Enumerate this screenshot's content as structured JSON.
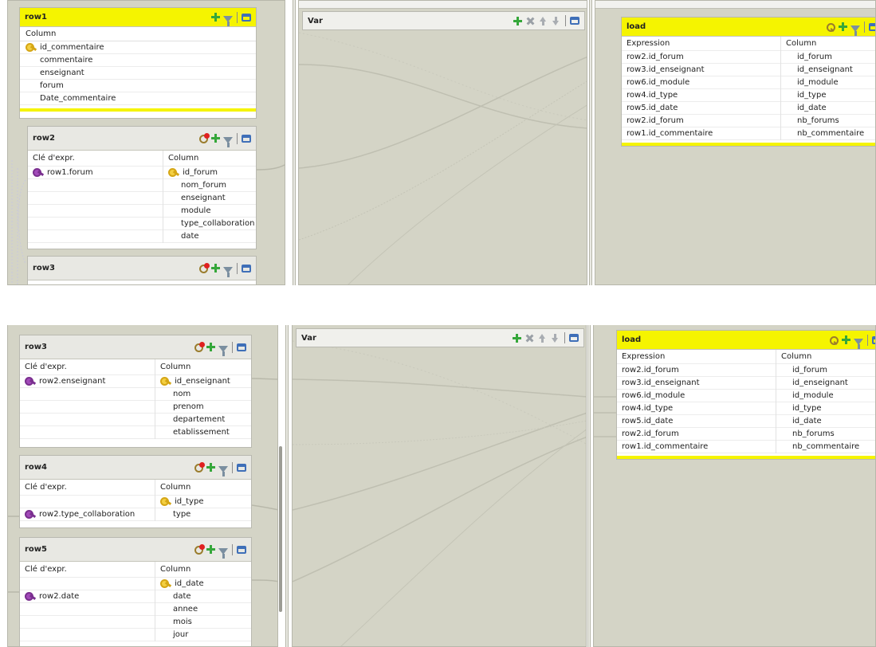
{
  "top": {
    "row1": {
      "title": "row1",
      "column_header": "Column",
      "columns": [
        "id_commentaire",
        "commentaire",
        "enseignant",
        "forum",
        "Date_commentaire"
      ]
    },
    "row2": {
      "title": "row2",
      "expr_header": "Clé d'expr.",
      "column_header": "Column",
      "expr_key": "row1.forum",
      "columns": [
        "id_forum",
        "nom_forum",
        "enseignant",
        "module",
        "type_collaboration",
        "date"
      ]
    },
    "row3": {
      "title": "row3"
    },
    "var": {
      "title": "Var"
    },
    "load": {
      "title": "load",
      "expression_header": "Expression",
      "column_header": "Column",
      "rows": [
        {
          "expr": "row2.id_forum",
          "col": "id_forum"
        },
        {
          "expr": "row3.id_enseignant",
          "col": "id_enseignant"
        },
        {
          "expr": "row6.id_module",
          "col": "id_module"
        },
        {
          "expr": "row4.id_type",
          "col": "id_type"
        },
        {
          "expr": "row5.id_date",
          "col": "id_date"
        },
        {
          "expr": "row2.id_forum",
          "col": "nb_forums"
        },
        {
          "expr": "row1.id_commentaire",
          "col": "nb_commentaire"
        }
      ]
    }
  },
  "bottom": {
    "row3": {
      "title": "row3",
      "expr_header": "Clé d'expr.",
      "column_header": "Column",
      "expr_key": "row2.enseignant",
      "columns": [
        "id_enseignant",
        "nom",
        "prenom",
        "departement",
        "etablissement"
      ]
    },
    "row4": {
      "title": "row4",
      "expr_header": "Clé d'expr.",
      "column_header": "Column",
      "expr_key": "row2.type_collaboration",
      "columns": [
        "id_type",
        "type"
      ]
    },
    "row5": {
      "title": "row5",
      "expr_header": "Clé d'expr.",
      "column_header": "Column",
      "expr_key": "row2.date",
      "columns": [
        "id_date",
        "date",
        "annee",
        "mois",
        "jour"
      ]
    },
    "var": {
      "title": "Var"
    },
    "load": {
      "title": "load",
      "expression_header": "Expression",
      "column_header": "Column",
      "rows": [
        {
          "expr": "row2.id_forum",
          "col": "id_forum"
        },
        {
          "expr": "row3.id_enseignant",
          "col": "id_enseignant"
        },
        {
          "expr": "row6.id_module",
          "col": "id_module"
        },
        {
          "expr": "row4.id_type",
          "col": "id_type"
        },
        {
          "expr": "row5.id_date",
          "col": "id_date"
        },
        {
          "expr": "row2.id_forum",
          "col": "nb_forums"
        },
        {
          "expr": "row1.id_commentaire",
          "col": "nb_commentaire"
        }
      ]
    }
  },
  "colors": {
    "header_yellow": "#f5f400",
    "canvas": "#d4d4c6",
    "key_yellow": "#f3cf42",
    "key_purple": "#a24ab9",
    "error_red": "#e02020",
    "add_green": "#35a73a"
  }
}
